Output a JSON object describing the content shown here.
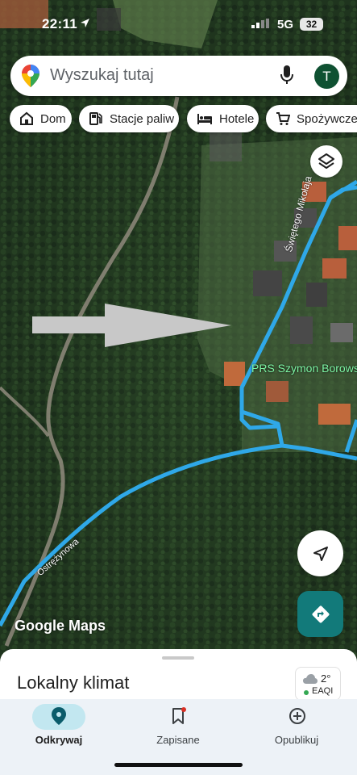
{
  "status_bar": {
    "time": "22:11",
    "network": "5G",
    "battery": "32"
  },
  "search": {
    "placeholder": "Wyszukaj tutaj",
    "avatar_letter": "T"
  },
  "chips": [
    {
      "label": "Dom",
      "icon": "home-icon"
    },
    {
      "label": "Stacje paliw",
      "icon": "gas-station-icon"
    },
    {
      "label": "Hotele",
      "icon": "hotel-bed-icon"
    },
    {
      "label": "Spożywcze",
      "icon": "shopping-cart-icon"
    }
  ],
  "map": {
    "watermark": "Google Maps",
    "place_label": "PRS Szymon Borows",
    "street_labels": [
      "Świętego Mikołaja",
      "Ostrężynowa"
    ],
    "route_color": "#2fa8e8",
    "arrow_annotation": "gray-arrow-right"
  },
  "bottom_sheet": {
    "title": "Lokalny klimat",
    "weather": {
      "temperature": "2°",
      "aqi_label": "EAQI",
      "aqi_color": "#34a853"
    }
  },
  "nav": {
    "items": [
      {
        "label": "Odkrywaj",
        "icon": "explore-pin-icon",
        "active": true
      },
      {
        "label": "Zapisane",
        "icon": "bookmark-icon",
        "active": false
      },
      {
        "label": "Opublikuj",
        "icon": "add-circle-icon",
        "active": false
      }
    ]
  },
  "colors": {
    "accent": "#127a7a",
    "active_nav": "#c2e7f0",
    "nav_background": "#edf2f7"
  }
}
